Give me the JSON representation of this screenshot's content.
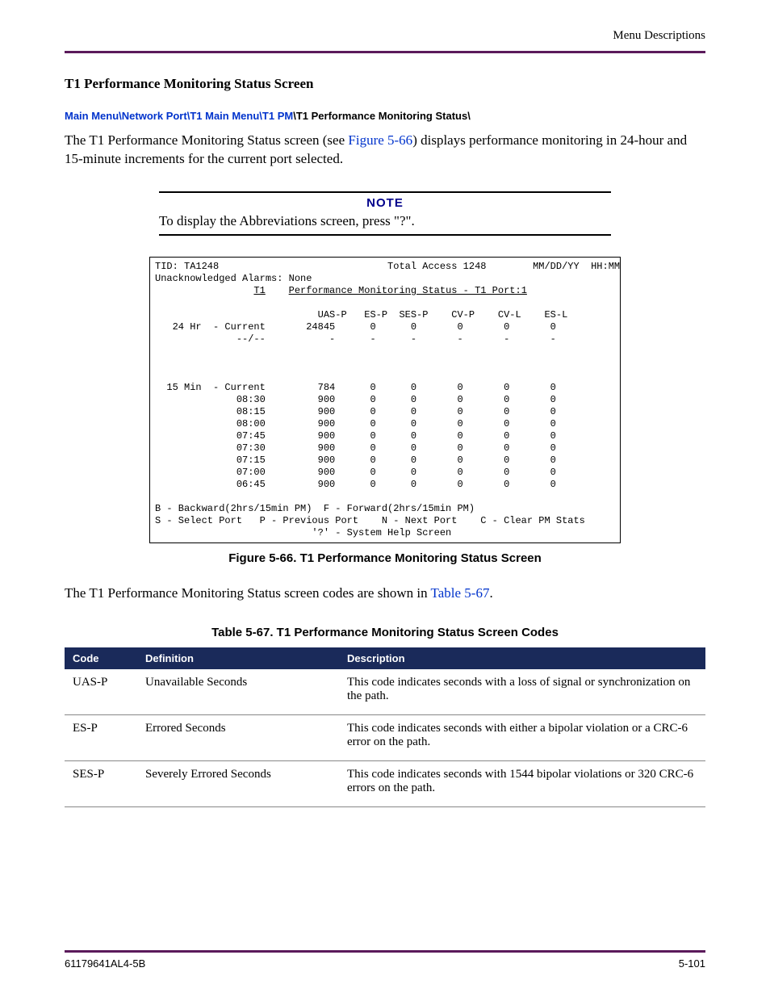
{
  "header": {
    "label": "Menu Descriptions"
  },
  "section": {
    "title": "T1 Performance Monitoring Status Screen"
  },
  "breadcrumb": {
    "links": [
      "Main Menu",
      "Network Port",
      "T1 Main Menu",
      "T1 PM"
    ],
    "current": "T1 Performance Monitoring Status\\"
  },
  "intro": {
    "before_link": "The T1 Performance Monitoring Status screen (see ",
    "figure_link": "Figure 5-66",
    "after_link": ") displays performance monitoring in 24-hour and 15-minute increments for the current port selected."
  },
  "note": {
    "label": "NOTE",
    "text": "To display the Abbreviations screen, press \"?\"."
  },
  "terminal": {
    "tid_label": "TID:",
    "tid_value": "TA1248",
    "device_name": "Total Access 1248",
    "datetime": "MM/DD/YY  HH:MM",
    "alarms_line": "Unacknowledged Alarms: None",
    "title_prefix": "T1",
    "title_text": "Performance Monitoring Status - T1 Port:1",
    "columns": [
      "UAS-P",
      "ES-P",
      "SES-P",
      "CV-P",
      "CV-L",
      "ES-L"
    ],
    "section_24hr": {
      "prefix": "24 Hr",
      "rows": [
        {
          "label": "- Current",
          "values": [
            "24845",
            "0",
            "0",
            "0",
            "0",
            "0"
          ]
        },
        {
          "label": "--/--",
          "values": [
            "-",
            "-",
            "-",
            "-",
            "-",
            "-"
          ]
        }
      ]
    },
    "section_15min": {
      "prefix": "15 Min",
      "rows": [
        {
          "label": "- Current",
          "values": [
            "784",
            "0",
            "0",
            "0",
            "0",
            "0"
          ]
        },
        {
          "label": "08:30",
          "values": [
            "900",
            "0",
            "0",
            "0",
            "0",
            "0"
          ]
        },
        {
          "label": "08:15",
          "values": [
            "900",
            "0",
            "0",
            "0",
            "0",
            "0"
          ]
        },
        {
          "label": "08:00",
          "values": [
            "900",
            "0",
            "0",
            "0",
            "0",
            "0"
          ]
        },
        {
          "label": "07:45",
          "values": [
            "900",
            "0",
            "0",
            "0",
            "0",
            "0"
          ]
        },
        {
          "label": "07:30",
          "values": [
            "900",
            "0",
            "0",
            "0",
            "0",
            "0"
          ]
        },
        {
          "label": "07:15",
          "values": [
            "900",
            "0",
            "0",
            "0",
            "0",
            "0"
          ]
        },
        {
          "label": "07:00",
          "values": [
            "900",
            "0",
            "0",
            "0",
            "0",
            "0"
          ]
        },
        {
          "label": "06:45",
          "values": [
            "900",
            "0",
            "0",
            "0",
            "0",
            "0"
          ]
        }
      ]
    },
    "help_line1": "B - Backward(2hrs/15min PM)  F - Forward(2hrs/15min PM)",
    "help_line2": "S - Select Port   P - Previous Port    N - Next Port    C - Clear PM Stats",
    "help_line3": "'?' - System Help Screen"
  },
  "figure_caption": "Figure 5-66.  T1 Performance Monitoring Status Screen",
  "post_text": {
    "before_link": "The T1 Performance Monitoring Status screen codes are shown in ",
    "table_link": "Table 5-67",
    "after_link": "."
  },
  "table": {
    "caption": "Table 5-67.  T1 Performance Monitoring Status Screen Codes",
    "headers": [
      "Code",
      "Definition",
      "Description"
    ],
    "rows": [
      {
        "code": "UAS-P",
        "definition": "Unavailable Seconds",
        "description": "This code indicates seconds with a loss of signal or synchronization on the path."
      },
      {
        "code": "ES-P",
        "definition": "Errored Seconds",
        "description": "This code indicates seconds with either a bipolar violation or a CRC-6 error on the path."
      },
      {
        "code": "SES-P",
        "definition": "Severely Errored Seconds",
        "description": "This code indicates seconds with 1544 bipolar violations or 320 CRC-6 errors on the path."
      }
    ]
  },
  "footer": {
    "left": "61179641AL4-5B",
    "right": "5-101"
  }
}
